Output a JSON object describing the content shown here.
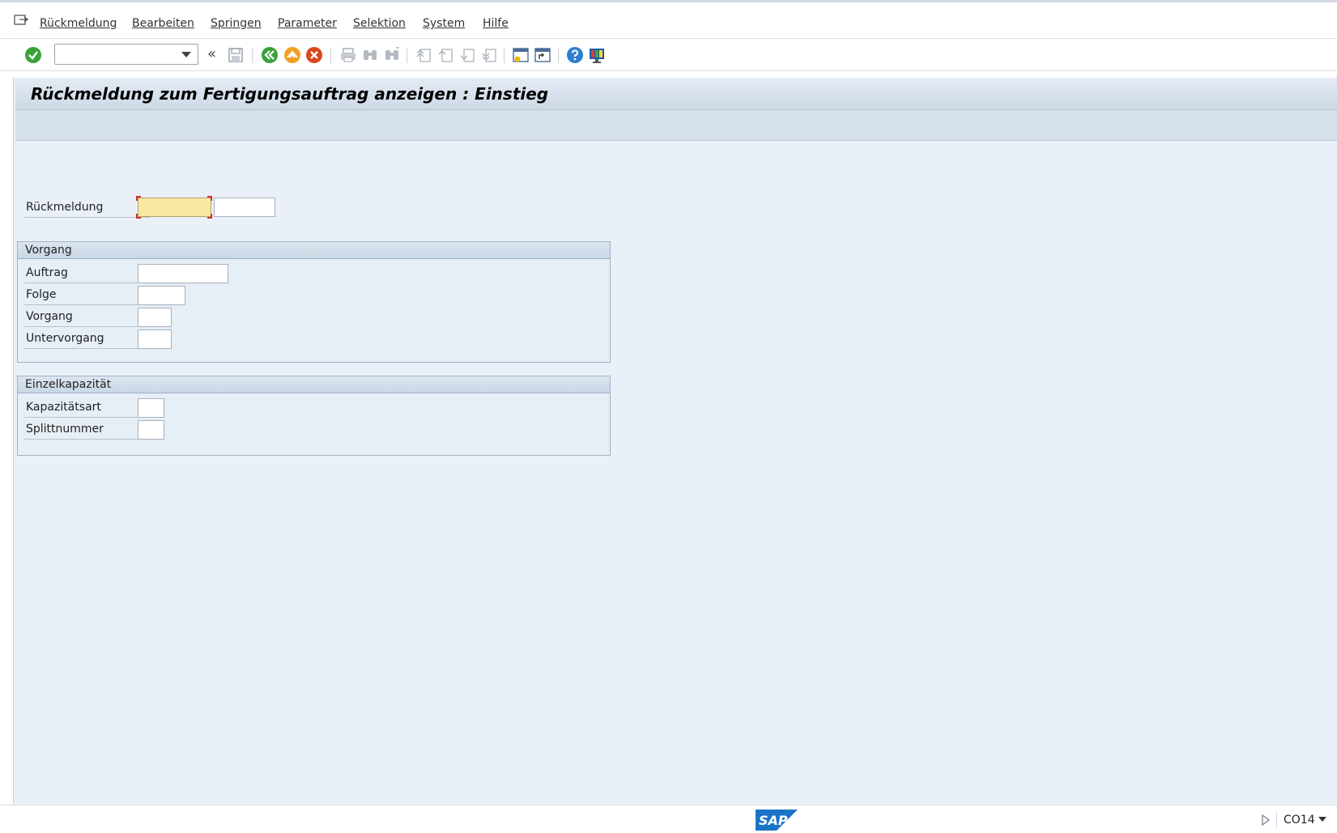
{
  "menubar": {
    "items": [
      {
        "label": "Rückmeldung"
      },
      {
        "label": "Bearbeiten"
      },
      {
        "label": "Springen"
      },
      {
        "label": "Parameter"
      },
      {
        "label": "Selektion"
      },
      {
        "label": "System"
      },
      {
        "label": "Hilfe"
      }
    ]
  },
  "toolbar": {
    "command_field": {
      "value": "",
      "placeholder": ""
    },
    "icons": [
      "enter-icon",
      "command-dropdown-icon",
      "collapse-icon",
      "save-icon",
      "back-icon",
      "exit-icon",
      "cancel-icon",
      "print-icon",
      "find-icon",
      "find-next-icon",
      "first-page-icon",
      "previous-page-icon",
      "next-page-icon",
      "last-page-icon",
      "new-session-icon",
      "create-shortcut-icon",
      "help-icon",
      "customize-layout-icon"
    ],
    "collapse_glyph": "«"
  },
  "screen": {
    "title": "Rückmeldung zum Fertigungsauftrag anzeigen : Einstieg",
    "rueckmeldung": {
      "label": "Rückmeldung",
      "value": "",
      "value2": ""
    },
    "vorgang_group": {
      "title": "Vorgang",
      "fields": {
        "auftrag": {
          "label": "Auftrag",
          "value": ""
        },
        "folge": {
          "label": "Folge",
          "value": ""
        },
        "vorgang": {
          "label": "Vorgang",
          "value": ""
        },
        "untervorgang": {
          "label": "Untervorgang",
          "value": ""
        }
      }
    },
    "einzelkapazitaet_group": {
      "title": "Einzelkapazität",
      "fields": {
        "kapazitaetsart": {
          "label": "Kapazitätsart",
          "value": ""
        },
        "splittnummer": {
          "label": "Splittnummer",
          "value": ""
        }
      }
    }
  },
  "statusbar": {
    "logo_text": "SAP",
    "transaction": "CO14"
  },
  "colors": {
    "background": "#e9f0f7",
    "required_field": "#fbe8a1",
    "accent_blue": "#1a73c7",
    "enter_green": "#3aa23a",
    "exit_orange": "#f0a020",
    "cancel_red": "#d9481c"
  }
}
